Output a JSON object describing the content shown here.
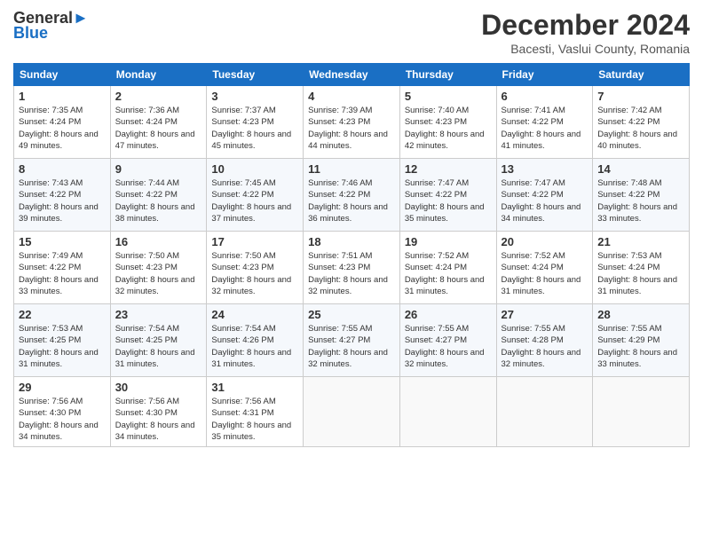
{
  "logo": {
    "line1": "General",
    "line2": "Blue"
  },
  "title": "December 2024",
  "subtitle": "Bacesti, Vaslui County, Romania",
  "days_of_week": [
    "Sunday",
    "Monday",
    "Tuesday",
    "Wednesday",
    "Thursday",
    "Friday",
    "Saturday"
  ],
  "weeks": [
    [
      {
        "day": "1",
        "sunrise": "7:35 AM",
        "sunset": "4:24 PM",
        "daylight": "8 hours and 49 minutes."
      },
      {
        "day": "2",
        "sunrise": "7:36 AM",
        "sunset": "4:24 PM",
        "daylight": "8 hours and 47 minutes."
      },
      {
        "day": "3",
        "sunrise": "7:37 AM",
        "sunset": "4:23 PM",
        "daylight": "8 hours and 45 minutes."
      },
      {
        "day": "4",
        "sunrise": "7:39 AM",
        "sunset": "4:23 PM",
        "daylight": "8 hours and 44 minutes."
      },
      {
        "day": "5",
        "sunrise": "7:40 AM",
        "sunset": "4:23 PM",
        "daylight": "8 hours and 42 minutes."
      },
      {
        "day": "6",
        "sunrise": "7:41 AM",
        "sunset": "4:22 PM",
        "daylight": "8 hours and 41 minutes."
      },
      {
        "day": "7",
        "sunrise": "7:42 AM",
        "sunset": "4:22 PM",
        "daylight": "8 hours and 40 minutes."
      }
    ],
    [
      {
        "day": "8",
        "sunrise": "7:43 AM",
        "sunset": "4:22 PM",
        "daylight": "8 hours and 39 minutes."
      },
      {
        "day": "9",
        "sunrise": "7:44 AM",
        "sunset": "4:22 PM",
        "daylight": "8 hours and 38 minutes."
      },
      {
        "day": "10",
        "sunrise": "7:45 AM",
        "sunset": "4:22 PM",
        "daylight": "8 hours and 37 minutes."
      },
      {
        "day": "11",
        "sunrise": "7:46 AM",
        "sunset": "4:22 PM",
        "daylight": "8 hours and 36 minutes."
      },
      {
        "day": "12",
        "sunrise": "7:47 AM",
        "sunset": "4:22 PM",
        "daylight": "8 hours and 35 minutes."
      },
      {
        "day": "13",
        "sunrise": "7:47 AM",
        "sunset": "4:22 PM",
        "daylight": "8 hours and 34 minutes."
      },
      {
        "day": "14",
        "sunrise": "7:48 AM",
        "sunset": "4:22 PM",
        "daylight": "8 hours and 33 minutes."
      }
    ],
    [
      {
        "day": "15",
        "sunrise": "7:49 AM",
        "sunset": "4:22 PM",
        "daylight": "8 hours and 33 minutes."
      },
      {
        "day": "16",
        "sunrise": "7:50 AM",
        "sunset": "4:23 PM",
        "daylight": "8 hours and 32 minutes."
      },
      {
        "day": "17",
        "sunrise": "7:50 AM",
        "sunset": "4:23 PM",
        "daylight": "8 hours and 32 minutes."
      },
      {
        "day": "18",
        "sunrise": "7:51 AM",
        "sunset": "4:23 PM",
        "daylight": "8 hours and 32 minutes."
      },
      {
        "day": "19",
        "sunrise": "7:52 AM",
        "sunset": "4:24 PM",
        "daylight": "8 hours and 31 minutes."
      },
      {
        "day": "20",
        "sunrise": "7:52 AM",
        "sunset": "4:24 PM",
        "daylight": "8 hours and 31 minutes."
      },
      {
        "day": "21",
        "sunrise": "7:53 AM",
        "sunset": "4:24 PM",
        "daylight": "8 hours and 31 minutes."
      }
    ],
    [
      {
        "day": "22",
        "sunrise": "7:53 AM",
        "sunset": "4:25 PM",
        "daylight": "8 hours and 31 minutes."
      },
      {
        "day": "23",
        "sunrise": "7:54 AM",
        "sunset": "4:25 PM",
        "daylight": "8 hours and 31 minutes."
      },
      {
        "day": "24",
        "sunrise": "7:54 AM",
        "sunset": "4:26 PM",
        "daylight": "8 hours and 31 minutes."
      },
      {
        "day": "25",
        "sunrise": "7:55 AM",
        "sunset": "4:27 PM",
        "daylight": "8 hours and 32 minutes."
      },
      {
        "day": "26",
        "sunrise": "7:55 AM",
        "sunset": "4:27 PM",
        "daylight": "8 hours and 32 minutes."
      },
      {
        "day": "27",
        "sunrise": "7:55 AM",
        "sunset": "4:28 PM",
        "daylight": "8 hours and 32 minutes."
      },
      {
        "day": "28",
        "sunrise": "7:55 AM",
        "sunset": "4:29 PM",
        "daylight": "8 hours and 33 minutes."
      }
    ],
    [
      {
        "day": "29",
        "sunrise": "7:56 AM",
        "sunset": "4:30 PM",
        "daylight": "8 hours and 34 minutes."
      },
      {
        "day": "30",
        "sunrise": "7:56 AM",
        "sunset": "4:30 PM",
        "daylight": "8 hours and 34 minutes."
      },
      {
        "day": "31",
        "sunrise": "7:56 AM",
        "sunset": "4:31 PM",
        "daylight": "8 hours and 35 minutes."
      },
      null,
      null,
      null,
      null
    ]
  ],
  "labels": {
    "sunrise": "Sunrise:",
    "sunset": "Sunset:",
    "daylight": "Daylight:"
  }
}
